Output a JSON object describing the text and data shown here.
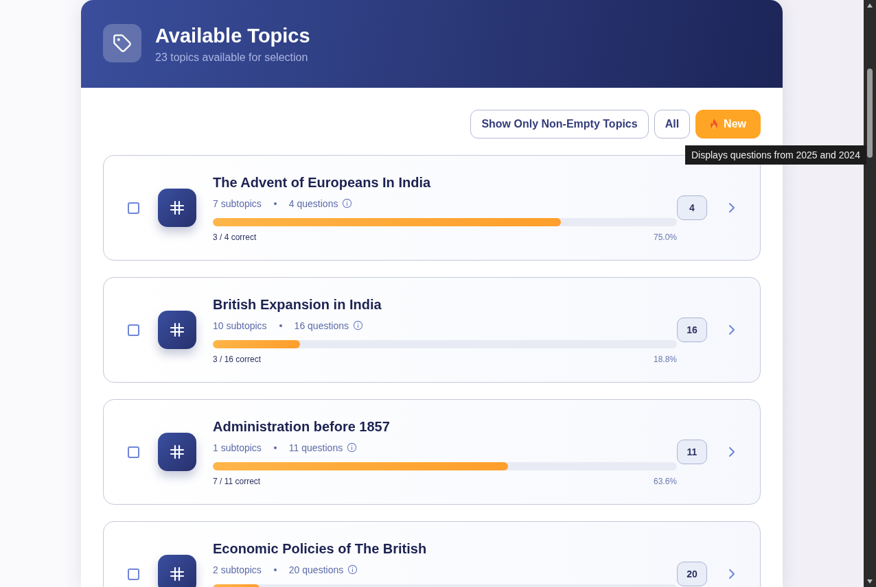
{
  "header": {
    "title": "Available Topics",
    "subtitle": "23 topics available for selection"
  },
  "filters": [
    {
      "label": "Show Only Non-Empty Topics",
      "kind": "outline"
    },
    {
      "label": "All",
      "kind": "outline"
    },
    {
      "label": "New",
      "kind": "accent"
    }
  ],
  "tooltip": "Displays questions from 2025 and 2024",
  "topics": [
    {
      "title": "The Advent of Europeans In India",
      "subtopics": "7 subtopics",
      "questions": "4 questions",
      "level": 0.75,
      "correct": "3 / 4 correct",
      "percent": "75.0%",
      "count": "4",
      "checked": false
    },
    {
      "title": "British Expansion in India",
      "subtopics": "10 subtopics",
      "questions": "16 questions",
      "level": 0.188,
      "correct": "3 / 16 correct",
      "percent": "18.8%",
      "count": "16",
      "checked": false
    },
    {
      "title": "Administration before 1857",
      "subtopics": "1 subtopics",
      "questions": "11 questions",
      "level": 0.636,
      "correct": "7 / 11 correct",
      "percent": "63.6%",
      "count": "11",
      "checked": false
    },
    {
      "title": "Economic Policies of The British",
      "subtopics": "2 subtopics",
      "questions": "20 questions",
      "level": 0.1,
      "count": "20",
      "checked": false
    }
  ]
}
